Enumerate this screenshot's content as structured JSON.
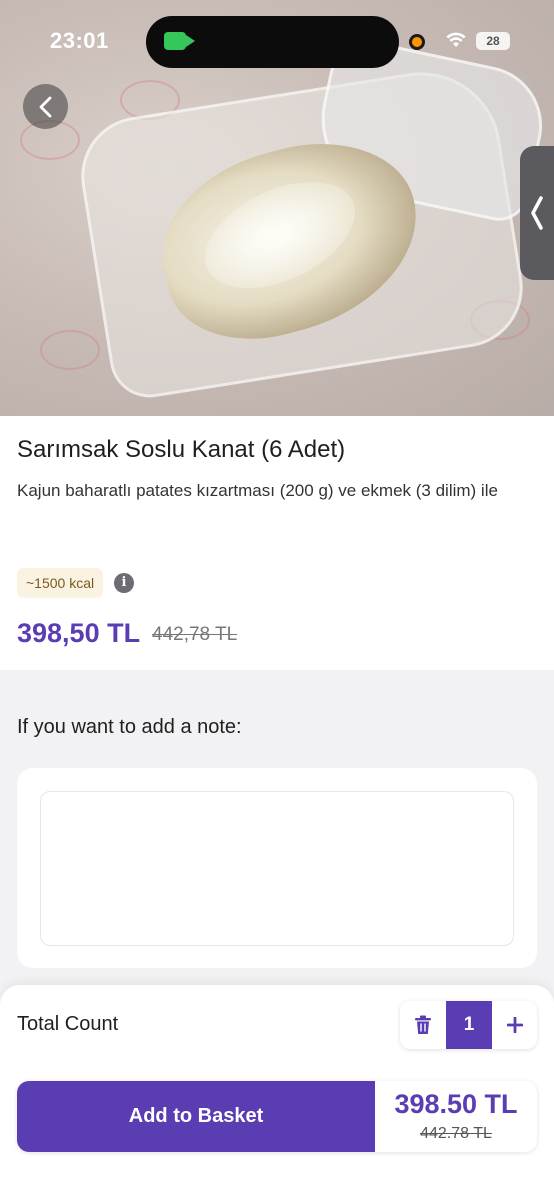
{
  "status_bar": {
    "time": "23:01",
    "battery": "28"
  },
  "product": {
    "title": "Sarımsak Soslu Kanat (6 Adet)",
    "description": "Kajun baharatlı patates kızartması (200 g) ve ekmek (3 dilim) ile",
    "calories": "~1500 kcal",
    "price": "398,50 TL",
    "old_price": "442,78 TL"
  },
  "note": {
    "label": "If you want to add a note:",
    "value": ""
  },
  "order": {
    "total_label": "Total Count",
    "quantity": "1",
    "button_label": "Add to Basket",
    "total_price": "398.50 TL",
    "total_old_price": "442.78 TL"
  },
  "colors": {
    "accent": "#5a3db3",
    "kcal_bg": "#fbf3e2"
  },
  "icons": {
    "back": "chevron-left-icon",
    "side": "chevron-left-icon",
    "info": "info-icon",
    "trash": "trash-icon",
    "plus": "plus-icon",
    "camera": "video-camera-icon",
    "wifi": "wifi-icon"
  }
}
